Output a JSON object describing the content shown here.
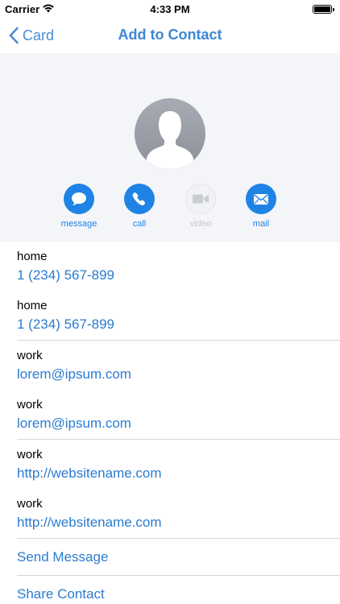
{
  "status_bar": {
    "carrier": "Carrier",
    "time": "4:33 PM",
    "wifi_icon": "wifi-icon",
    "battery_icon": "battery-icon"
  },
  "nav": {
    "back_label": "Card",
    "title": "Add to Contact",
    "accent_color": "#3d87d4"
  },
  "actions": [
    {
      "label": "message",
      "icon": "message-bubble-icon",
      "enabled": true
    },
    {
      "label": "call",
      "icon": "phone-icon",
      "enabled": true
    },
    {
      "label": "video",
      "icon": "video-camera-icon",
      "enabled": false
    },
    {
      "label": "mail",
      "icon": "envelope-icon",
      "enabled": true
    }
  ],
  "rows": [
    {
      "kind": "home",
      "value": "1 (234) 567-899"
    },
    {
      "kind": "home",
      "value": "1 (234) 567-899"
    },
    {
      "kind": "work",
      "value": "lorem@ipsum.com"
    },
    {
      "kind": "work",
      "value": "lorem@ipsum.com"
    },
    {
      "kind": "work",
      "value": "http://websitename.com"
    },
    {
      "kind": "work",
      "value": "http://websitename.com"
    }
  ],
  "bottom_actions": {
    "send_message": "Send Message",
    "share_contact": "Share Contact"
  },
  "colors": {
    "link_blue": "#2a7bd0",
    "action_blue": "#1f83e6",
    "header_bg": "#f4f5f9"
  }
}
